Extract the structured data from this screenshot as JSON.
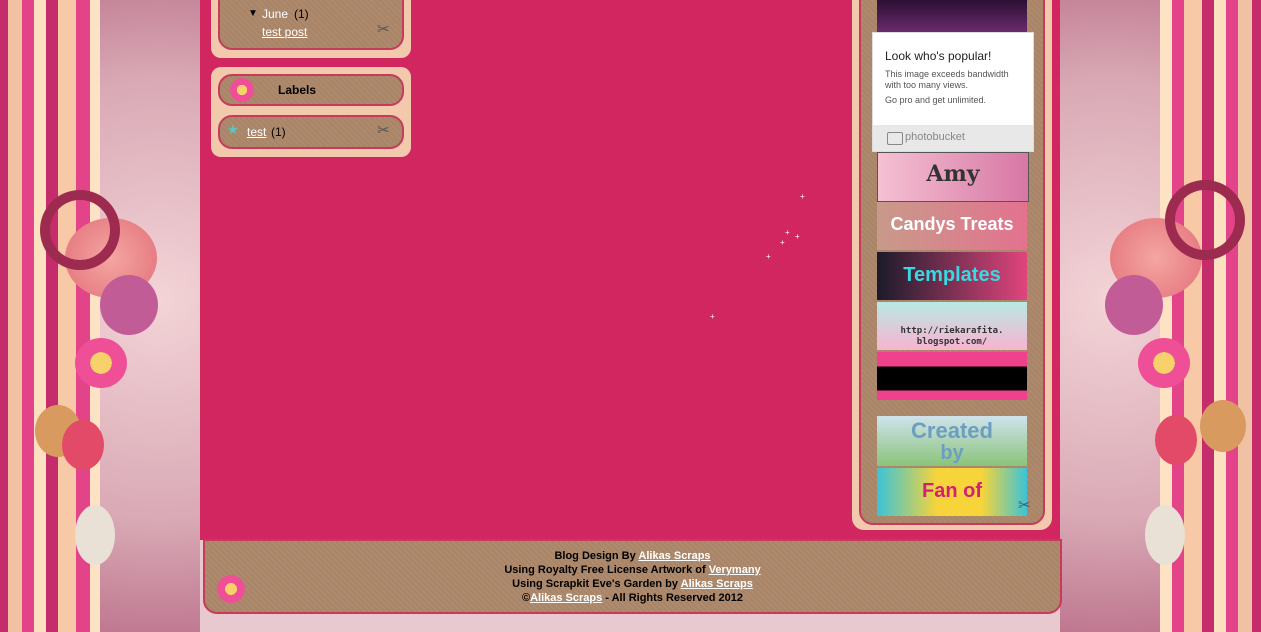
{
  "archive": {
    "expand_icon": "triangle-down-icon",
    "month": "June",
    "month_count": "(1)",
    "post_link": "test post"
  },
  "labels_widget": {
    "title": "Labels",
    "items": [
      {
        "label": "test",
        "count": "(1)"
      }
    ]
  },
  "photobucket": {
    "heading": "Look who's popular!",
    "line1": "This image exceeds bandwidth",
    "line2": "with too many views.",
    "line3": "Go pro and get unlimited.",
    "brand": "photobucket"
  },
  "banners": {
    "amy": "Amy",
    "candy": "Candys Treats",
    "templates": "Templates",
    "rieka_url_1": "http://riekarafita.",
    "rieka_url_2": "blogspot.com/",
    "created_by_1": "Created",
    "created_by_2": "by",
    "fan_of": "Fan of"
  },
  "footer": {
    "line1_prefix": "Blog Design By ",
    "line1_link": "Alikas Scraps",
    "line2_prefix": "Using Royalty Free License Artwork of ",
    "line2_link": "Verymany",
    "line3_prefix": "Using Scrapkit Eve's Garden by ",
    "line3_link": "Alikas Scraps",
    "line4_prefix": "©",
    "line4_link": "Alikas Scraps",
    "line4_suffix": " - All Rights Reserved 2012"
  },
  "colors": {
    "main_bg": "#d22661",
    "widget_bg": "#f2c9ad",
    "pill_bg": "#a98466",
    "border": "#c63b5b"
  }
}
